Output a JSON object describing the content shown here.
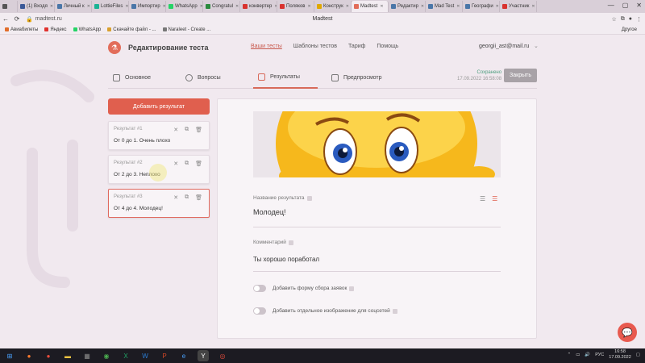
{
  "browser": {
    "tabs": [
      {
        "label": "",
        "color": "#555"
      },
      {
        "label": "(1) Входя",
        "color": "#3b5998"
      },
      {
        "label": "Личный к",
        "color": "#4a76a8"
      },
      {
        "label": "LottieFiles",
        "color": "#1ab394"
      },
      {
        "label": "Импортир",
        "color": "#4a76a8"
      },
      {
        "label": "WhatsApp",
        "color": "#25d366"
      },
      {
        "label": "Congratul",
        "color": "#2b8a3e"
      },
      {
        "label": "конвертер",
        "color": "#d9322e"
      },
      {
        "label": "Поляков",
        "color": "#d9322e"
      },
      {
        "label": "Конструк",
        "color": "#e0a800"
      },
      {
        "label": "Madtest",
        "color": "#e26d5a",
        "active": true
      },
      {
        "label": "Редактир",
        "color": "#4a76a8"
      },
      {
        "label": "Mad Test",
        "color": "#4a76a8"
      },
      {
        "label": "Географи",
        "color": "#4a76a8"
      },
      {
        "label": "Участник",
        "color": "#d9322e"
      }
    ],
    "url": "madtest.ru",
    "page_title": "Madtest",
    "bookmarks": [
      {
        "label": "Авиабилеты",
        "color": "#e26d2a"
      },
      {
        "label": "Яндекс",
        "color": "#e0322e"
      },
      {
        "label": "WhatsApp",
        "color": "#25d366"
      },
      {
        "label": "Скачайте файл - ...",
        "color": "#d9a02e"
      },
      {
        "label": "Naraleet - Create ...",
        "color": "#777777"
      }
    ],
    "other_bookmarks": "Другое"
  },
  "header": {
    "title": "Редактирование теста",
    "nav": [
      "Ваши тесты",
      "Шаблоны тестов",
      "Тариф",
      "Помощь"
    ],
    "user_email": "georgii_ast@mail.ru"
  },
  "steps": {
    "tabs": [
      "Основное",
      "Вопросы",
      "Результаты",
      "Предпросмотр"
    ],
    "saved_label": "Сохранено",
    "saved_time": "17.09.2022 16:58:08",
    "close_label": "Закрыть"
  },
  "results": {
    "add_label": "Добавить результат",
    "items": [
      {
        "label": "Результат #1",
        "text": "От 0 до 1. Очень плохо"
      },
      {
        "label": "Результат #2",
        "text": "От 2 до 3. Неплохо"
      },
      {
        "label": "Результат #3",
        "text": "От 4 до 4. Молодец!"
      }
    ]
  },
  "editor": {
    "name_label": "Название результата",
    "name_value": "Молодец!",
    "comment_label": "Комментарий",
    "comment_value": "Ты хорошо поработал",
    "toggle1_label": "Добавить форму сбора заявок",
    "toggle2_label": "Добавить отдельное изображение для соцсетей"
  },
  "taskbar": {
    "lang": "РУС",
    "time": "16:58",
    "date": "17.09.2022"
  },
  "colors": {
    "accent": "#e05f4e",
    "saved_green": "#4a9d7c"
  }
}
